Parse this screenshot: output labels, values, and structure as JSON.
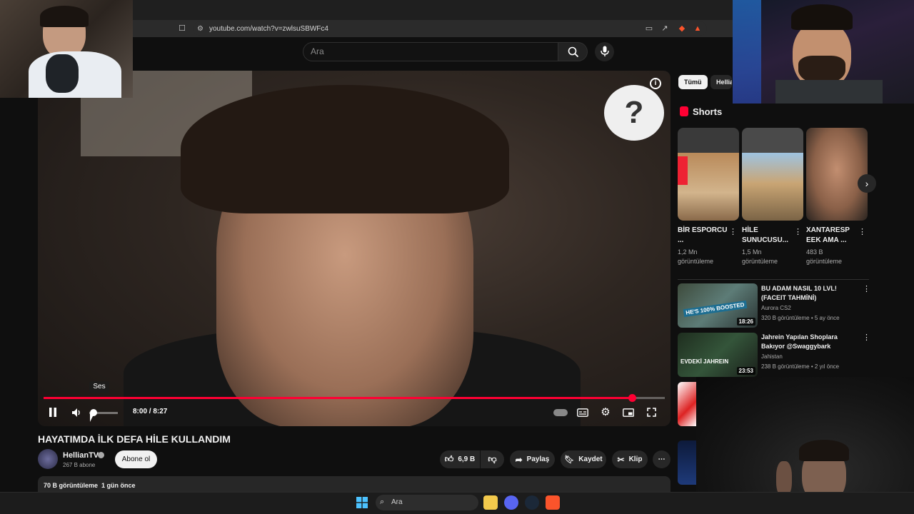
{
  "browser": {
    "url": "youtube.com/watch?v=zwlsuSBWFc4"
  },
  "youtube_header": {
    "search_placeholder": "Ara"
  },
  "player": {
    "tooltip": "Ses",
    "time_display": "8:00 / 8:27",
    "progress_fraction": 0.947,
    "volume_fraction": 0.15
  },
  "video": {
    "title": "HAYATIMDA İLK DEFA HİLE KULLANDIM",
    "channel": "HellianTV",
    "subscribers": "267 B abone",
    "subscribe_label": "Abone ol",
    "likes": "6,9 B",
    "share_label": "Paylaş",
    "save_label": "Kaydet",
    "clip_label": "Klip",
    "stats": "70 B görüntüleme  1 gün önce"
  },
  "filters": {
    "chips": [
      "Tümü",
      "Hellia"
    ]
  },
  "shorts": {
    "heading": "Shorts",
    "items": [
      {
        "title": "BİR ESPORCU ...",
        "views": "1,2 Mn görüntüleme"
      },
      {
        "title": "HİLE SUNUCUSU...",
        "views": "1,5 Mn görüntüleme"
      },
      {
        "title": "XANTARESP EEK AMA ...",
        "views": "483 B görüntüleme"
      }
    ]
  },
  "recommendations": [
    {
      "title": "BU ADAM NASIL 10 LVL! (FACEIT TAHMİNİ)",
      "channel": "Aurora CS2",
      "meta": "320 B görüntüleme • 5 ay önce",
      "duration": "18:26",
      "thumb_text": "HE'S 100% BOOSTED"
    },
    {
      "title": "Jahrein Yapılan Shoplara Bakıyor @Swaggybark",
      "channel": "Jahistan",
      "meta": "238 B görüntüleme • 2 yıl önce",
      "duration": "23:53",
      "thumb_text": "EVDEKİ JAHREIN"
    }
  ],
  "taskbar": {
    "search_placeholder": "Ara"
  },
  "colors": {
    "accent": "#ff0033",
    "background": "#0f0f0f",
    "surface": "#272727"
  }
}
